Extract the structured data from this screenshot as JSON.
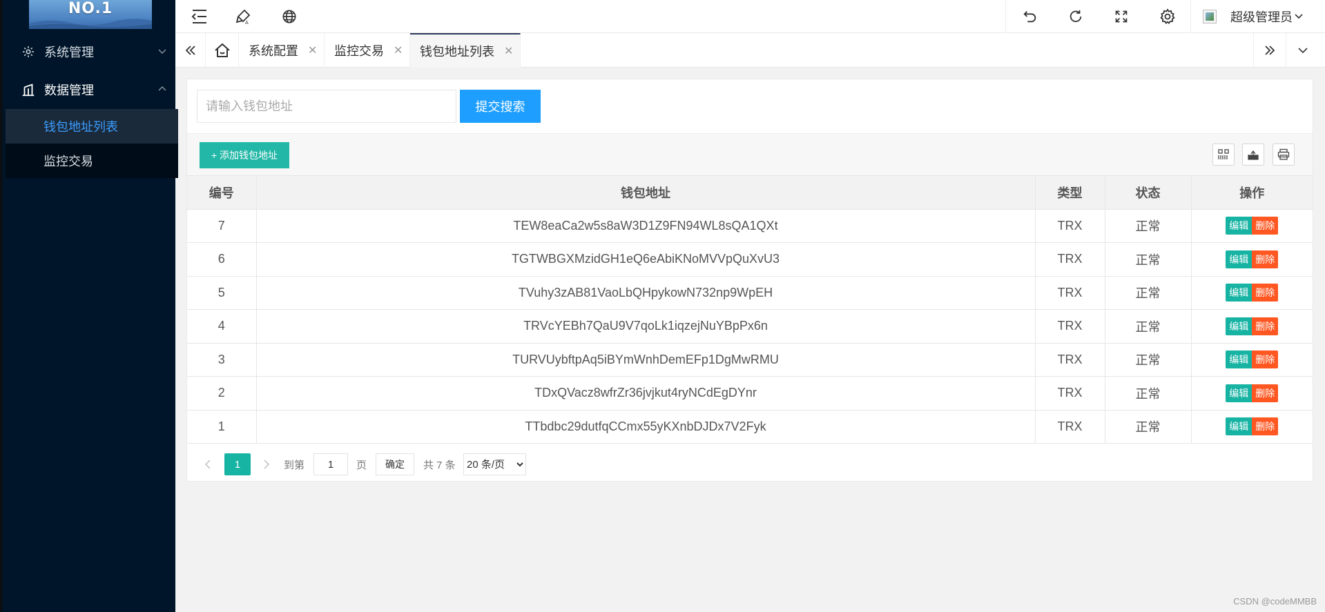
{
  "sidebar": {
    "logo_text": "NO.1",
    "menus": [
      {
        "label": "系统管理",
        "icon": "gear-icon"
      },
      {
        "label": "数据管理",
        "icon": "chart-icon"
      }
    ],
    "sub_items": [
      {
        "label": "钱包地址列表",
        "active": true
      },
      {
        "label": "监控交易",
        "active": false
      }
    ]
  },
  "header": {
    "user_name": "超级管理员"
  },
  "tabs": [
    {
      "label": "系统配置"
    },
    {
      "label": "监控交易"
    },
    {
      "label": "钱包地址列表"
    }
  ],
  "search": {
    "placeholder": "请输入钱包地址",
    "button_label": "提交搜索"
  },
  "toolbar": {
    "add_label": "+ 添加钱包地址"
  },
  "table": {
    "columns": [
      "编号",
      "钱包地址",
      "类型",
      "状态",
      "操作"
    ],
    "edit_label": "编辑",
    "delete_label": "删除",
    "rows": [
      {
        "id": "7",
        "address": "TEW8eaCa2w5s8aW3D1Z9FN94WL8sQA1QXt",
        "type": "TRX",
        "status": "正常"
      },
      {
        "id": "6",
        "address": "TGTWBGXMzidGH1eQ6eAbiKNoMVVpQuXvU3",
        "type": "TRX",
        "status": "正常"
      },
      {
        "id": "5",
        "address": "TVuhy3zAB81VaoLbQHpykowN732np9WpEH",
        "type": "TRX",
        "status": "正常"
      },
      {
        "id": "4",
        "address": "TRVcYEBh7QaU9V7qoLk1iqzejNuYBpPx6n",
        "type": "TRX",
        "status": "正常"
      },
      {
        "id": "3",
        "address": "TURVUybftpAq5iBYmWnhDemEFp1DgMwRMU",
        "type": "TRX",
        "status": "正常"
      },
      {
        "id": "2",
        "address": "TDxQVacz8wfrZr36jvjkut4ryNCdEgDYnr",
        "type": "TRX",
        "status": "正常"
      },
      {
        "id": "1",
        "address": "TTbdbc29dutfqCCmx55yKXnbDJDx7V2Fyk",
        "type": "TRX",
        "status": "正常"
      }
    ]
  },
  "pager": {
    "current_page": "1",
    "goto_label": "到第",
    "goto_value": "1",
    "page_unit": "页",
    "confirm_label": "确定",
    "total_label": "共 7 条",
    "page_size": "20 条/页"
  },
  "watermark": "CSDN @codeMMBB"
}
